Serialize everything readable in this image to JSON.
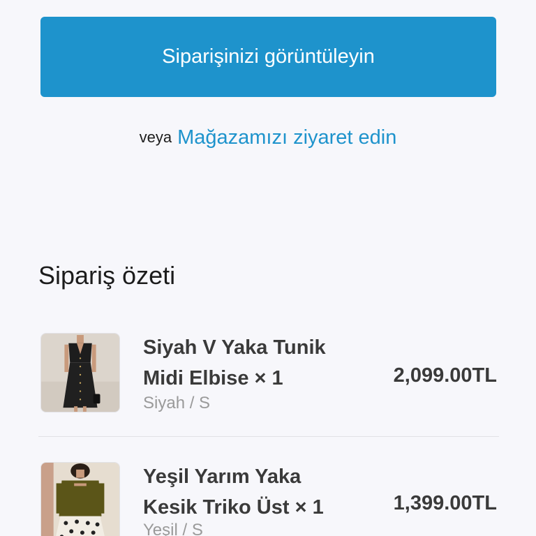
{
  "actions": {
    "view_order_label": "Siparişinizi görüntüleyin",
    "or_text": "veya",
    "visit_store_label": "Mağazamızı ziyaret edin"
  },
  "summary": {
    "title": "Sipariş özeti",
    "items": [
      {
        "name": "Siyah V Yaka Tunik Midi Elbise × 1",
        "variant": "Siyah / S",
        "price": "2,099.00TL",
        "image_icon": "black-dress-image"
      },
      {
        "name": "Yeşil Yarım Yaka Kesik Triko Üst × 1",
        "variant": "Yeşil / S",
        "price": "1,399.00TL",
        "image_icon": "green-knit-top-image"
      }
    ]
  },
  "colors": {
    "accent": "#1e93cc",
    "background": "#f7f7fb"
  }
}
